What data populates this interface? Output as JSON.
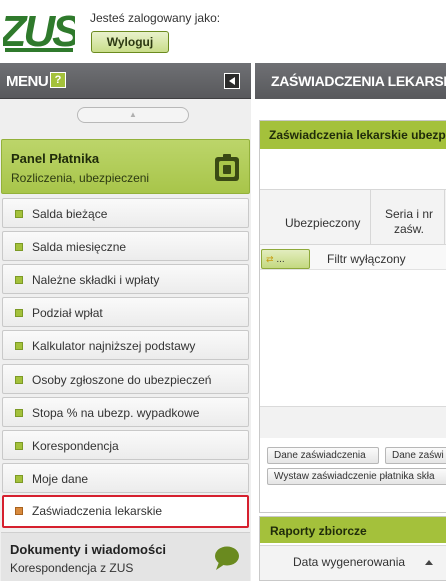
{
  "header": {
    "logo_text": "ZUS",
    "logged_in_as": "Jesteś zalogowany jako:",
    "logout_label": "Wyloguj"
  },
  "menu": {
    "title": "MENU",
    "help_label": "?",
    "panel": {
      "title": "Panel Płatnika",
      "subtitle": "Rozliczenia, ubezpieczeni"
    },
    "items": [
      {
        "label": "Salda bieżące"
      },
      {
        "label": "Salda miesięczne"
      },
      {
        "label": "Należne składki i wpłaty"
      },
      {
        "label": "Podział wpłat"
      },
      {
        "label": "Kalkulator najniższej podstawy"
      },
      {
        "label": "Osoby zgłoszone do ubezpieczeń"
      },
      {
        "label": "Stopa % na ubezp. wypadkowe"
      },
      {
        "label": "Korespondencja"
      },
      {
        "label": "Moje dane"
      },
      {
        "label": "Zaświadczenia lekarskie",
        "active": true
      }
    ],
    "docs": {
      "title": "Dokumenty i wiadomości",
      "subtitle": "Korespondencja z ZUS"
    }
  },
  "main": {
    "title": "ZAŚWIADCZENIA LEKARSKIE",
    "certificates_panel": {
      "title": "Zaświadczenia lekarskie ubezp",
      "columns": [
        "Ubezpieczony",
        "Seria i nr zaśw."
      ],
      "filter_button": "...",
      "filter_status": "Filtr wyłączony",
      "buttons": [
        "Dane zaświadczenia",
        "Dane zaświ"
      ],
      "issue_button": "Wystaw zaświadczenie płatnika skła"
    },
    "reports_panel": {
      "title": "Raporty zbiorcze",
      "column": "Data wygenerowania"
    }
  },
  "colors": {
    "accent_green": "#a4c13b",
    "header_grey": "#626366",
    "active_border": "#d6202e"
  }
}
